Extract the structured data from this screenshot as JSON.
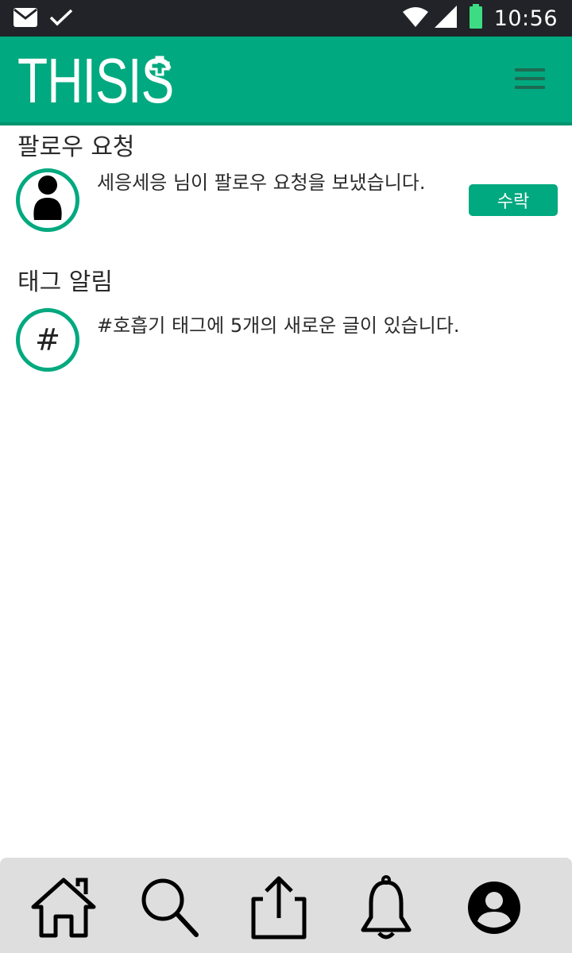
{
  "status_bar": {
    "time": "10:56",
    "icons": [
      "mail-icon",
      "check-icon",
      "wifi-icon",
      "signal-icon",
      "battery-icon"
    ],
    "battery_color": "#3ddc84"
  },
  "header": {
    "logo_text": "THISIS",
    "logo_mark": "plus-icon",
    "menu_icon": "hamburger-menu-icon",
    "brand_color": "#00a97f"
  },
  "follow_requests": {
    "title": "팔로우 요청",
    "items": [
      {
        "avatar_icon": "user-icon",
        "message": "세응세응 님이 팔로우 요청을 보냈습니다.",
        "accept_label": "수락"
      }
    ]
  },
  "tag_alerts": {
    "title": "태그 알림",
    "items": [
      {
        "avatar_glyph": "#",
        "message": "#호흡기 태그에 5개의 새로운 글이 있습니다."
      }
    ]
  },
  "bottom_nav": {
    "items": [
      "home-icon",
      "search-icon",
      "share-icon",
      "bell-icon",
      "profile-icon"
    ],
    "active": "profile-icon"
  }
}
